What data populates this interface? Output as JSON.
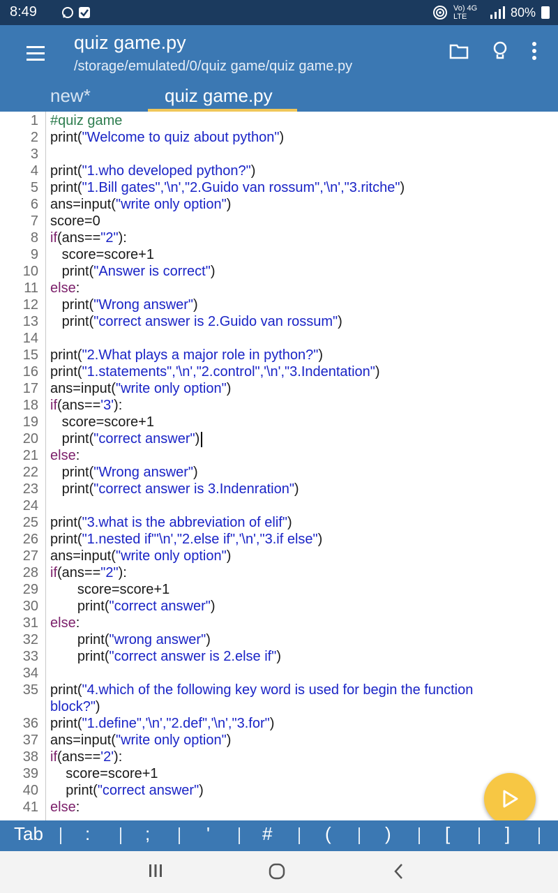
{
  "status": {
    "time": "8:49",
    "network_label": "Vo) 4G LTE",
    "battery": "80%",
    "icons": [
      "whatsapp-icon",
      "check-icon",
      "hotspot-icon",
      "signal-icon",
      "battery-icon"
    ]
  },
  "header": {
    "title": "quiz game.py",
    "path": "/storage/emulated/0/quiz game/quiz game.py",
    "icons": [
      "menu-icon",
      "folder-icon",
      "lightbulb-icon",
      "more-icon"
    ]
  },
  "tabs": [
    {
      "label": "new*",
      "active": false
    },
    {
      "label": "quiz game.py",
      "active": true
    }
  ],
  "editor": {
    "lines": [
      {
        "num": "1",
        "indent": "",
        "segs": [
          {
            "t": "#quiz game",
            "c": "comment"
          }
        ]
      },
      {
        "num": "2",
        "indent": "",
        "segs": [
          {
            "t": "print(",
            "c": "plain"
          },
          {
            "t": "\"Welcome to quiz about python\"",
            "c": "str"
          },
          {
            "t": ")",
            "c": "plain"
          }
        ]
      },
      {
        "num": "3",
        "indent": "",
        "segs": []
      },
      {
        "num": "4",
        "indent": "",
        "segs": [
          {
            "t": "print(",
            "c": "plain"
          },
          {
            "t": "\"1.who developed python?\"",
            "c": "str"
          },
          {
            "t": ")",
            "c": "plain"
          }
        ]
      },
      {
        "num": "5",
        "indent": "",
        "segs": [
          {
            "t": "print(",
            "c": "plain"
          },
          {
            "t": "\"1.Bill gates\",'\\n',\"2.Guido van rossum\",'\\n',\"3.ritche\"",
            "c": "str"
          },
          {
            "t": ")",
            "c": "plain"
          }
        ]
      },
      {
        "num": "6",
        "indent": "",
        "segs": [
          {
            "t": "ans=input(",
            "c": "plain"
          },
          {
            "t": "\"write only option\"",
            "c": "str"
          },
          {
            "t": ")",
            "c": "plain"
          }
        ]
      },
      {
        "num": "7",
        "indent": "",
        "segs": [
          {
            "t": "score=0",
            "c": "plain"
          }
        ]
      },
      {
        "num": "8",
        "indent": "",
        "segs": [
          {
            "t": "if",
            "c": "kw"
          },
          {
            "t": "(ans==",
            "c": "plain"
          },
          {
            "t": "\"2\"",
            "c": "str"
          },
          {
            "t": "):",
            "c": "plain"
          }
        ]
      },
      {
        "num": "9",
        "indent": "   ",
        "segs": [
          {
            "t": "score=score+1",
            "c": "plain"
          }
        ]
      },
      {
        "num": "10",
        "indent": "   ",
        "segs": [
          {
            "t": "print(",
            "c": "plain"
          },
          {
            "t": "\"Answer is correct\"",
            "c": "str"
          },
          {
            "t": ")",
            "c": "plain"
          }
        ]
      },
      {
        "num": "11",
        "indent": "",
        "segs": [
          {
            "t": "else",
            "c": "kw"
          },
          {
            "t": ":",
            "c": "plain"
          }
        ]
      },
      {
        "num": "12",
        "indent": "   ",
        "segs": [
          {
            "t": "print(",
            "c": "plain"
          },
          {
            "t": "\"Wrong answer\"",
            "c": "str"
          },
          {
            "t": ")",
            "c": "plain"
          }
        ]
      },
      {
        "num": "13",
        "indent": "   ",
        "segs": [
          {
            "t": "print(",
            "c": "plain"
          },
          {
            "t": "\"correct answer is 2.Guido van rossum\"",
            "c": "str"
          },
          {
            "t": ")",
            "c": "plain"
          }
        ]
      },
      {
        "num": "14",
        "indent": "",
        "segs": []
      },
      {
        "num": "15",
        "indent": "",
        "segs": [
          {
            "t": "print(",
            "c": "plain"
          },
          {
            "t": "\"2.What plays a major role in python?\"",
            "c": "str"
          },
          {
            "t": ")",
            "c": "plain"
          }
        ]
      },
      {
        "num": "16",
        "indent": "",
        "segs": [
          {
            "t": "print(",
            "c": "plain"
          },
          {
            "t": "\"1.statements\",'\\n',\"2.control\",'\\n',\"3.Indentation\"",
            "c": "str"
          },
          {
            "t": ")",
            "c": "plain"
          }
        ]
      },
      {
        "num": "17",
        "indent": "",
        "segs": [
          {
            "t": "ans=input(",
            "c": "plain"
          },
          {
            "t": "\"write only option\"",
            "c": "str"
          },
          {
            "t": ")",
            "c": "plain"
          }
        ]
      },
      {
        "num": "18",
        "indent": "",
        "segs": [
          {
            "t": "if",
            "c": "kw"
          },
          {
            "t": "(ans==",
            "c": "plain"
          },
          {
            "t": "'3'",
            "c": "str"
          },
          {
            "t": "):",
            "c": "plain"
          }
        ]
      },
      {
        "num": "19",
        "indent": "   ",
        "segs": [
          {
            "t": "score=score+1",
            "c": "plain"
          }
        ]
      },
      {
        "num": "20",
        "indent": "   ",
        "segs": [
          {
            "t": "print(",
            "c": "plain"
          },
          {
            "t": "\"correct answer\"",
            "c": "str"
          },
          {
            "t": ")",
            "c": "plain"
          }
        ],
        "cursor": true
      },
      {
        "num": "21",
        "indent": "",
        "segs": [
          {
            "t": "else",
            "c": "kw"
          },
          {
            "t": ":",
            "c": "plain"
          }
        ]
      },
      {
        "num": "22",
        "indent": "   ",
        "segs": [
          {
            "t": "print(",
            "c": "plain"
          },
          {
            "t": "\"Wrong answer\"",
            "c": "str"
          },
          {
            "t": ")",
            "c": "plain"
          }
        ]
      },
      {
        "num": "23",
        "indent": "   ",
        "segs": [
          {
            "t": "print(",
            "c": "plain"
          },
          {
            "t": "\"correct answer is 3.Indenration\"",
            "c": "str"
          },
          {
            "t": ")",
            "c": "plain"
          }
        ]
      },
      {
        "num": "24",
        "indent": "",
        "segs": []
      },
      {
        "num": "25",
        "indent": "",
        "segs": [
          {
            "t": "print(",
            "c": "plain"
          },
          {
            "t": "\"3.what is the abbreviation of elif\"",
            "c": "str"
          },
          {
            "t": ")",
            "c": "plain"
          }
        ]
      },
      {
        "num": "26",
        "indent": "",
        "segs": [
          {
            "t": "print(",
            "c": "plain"
          },
          {
            "t": "\"1.nested if\"'\\n',\"2.else if\",'\\n',\"3.if else\"",
            "c": "str"
          },
          {
            "t": ")",
            "c": "plain"
          }
        ]
      },
      {
        "num": "27",
        "indent": "",
        "segs": [
          {
            "t": "ans=input(",
            "c": "plain"
          },
          {
            "t": "\"write only option\"",
            "c": "str"
          },
          {
            "t": ")",
            "c": "plain"
          }
        ]
      },
      {
        "num": "28",
        "indent": "",
        "segs": [
          {
            "t": "if",
            "c": "kw"
          },
          {
            "t": "(ans==",
            "c": "plain"
          },
          {
            "t": "\"2\"",
            "c": "str"
          },
          {
            "t": "):",
            "c": "plain"
          }
        ]
      },
      {
        "num": "29",
        "indent": "       ",
        "segs": [
          {
            "t": "score=score+1",
            "c": "plain"
          }
        ]
      },
      {
        "num": "30",
        "indent": "       ",
        "segs": [
          {
            "t": "print(",
            "c": "plain"
          },
          {
            "t": "\"correct answer\"",
            "c": "str"
          },
          {
            "t": ")",
            "c": "plain"
          }
        ]
      },
      {
        "num": "31",
        "indent": "",
        "segs": [
          {
            "t": "else",
            "c": "kw"
          },
          {
            "t": ":",
            "c": "plain"
          }
        ]
      },
      {
        "num": "32",
        "indent": "       ",
        "segs": [
          {
            "t": "print(",
            "c": "plain"
          },
          {
            "t": "\"wrong answer\"",
            "c": "str"
          },
          {
            "t": ")",
            "c": "plain"
          }
        ]
      },
      {
        "num": "33",
        "indent": "       ",
        "segs": [
          {
            "t": "print(",
            "c": "plain"
          },
          {
            "t": "\"correct answer is 2.else if\"",
            "c": "str"
          },
          {
            "t": ")",
            "c": "plain"
          }
        ]
      },
      {
        "num": "34",
        "indent": "",
        "segs": []
      },
      {
        "num": "35",
        "indent": "",
        "segs": [
          {
            "t": "print(",
            "c": "plain"
          },
          {
            "t": "\"4.which of the following key word is used for begin the function",
            "c": "str"
          }
        ]
      },
      {
        "num": "",
        "indent": "",
        "segs": [
          {
            "t": "block?\"",
            "c": "str"
          },
          {
            "t": ")",
            "c": "plain"
          }
        ]
      },
      {
        "num": "36",
        "indent": "",
        "segs": [
          {
            "t": "print(",
            "c": "plain"
          },
          {
            "t": "\"1.define\",'\\n',\"2.def\",'\\n',\"3.for\"",
            "c": "str"
          },
          {
            "t": ")",
            "c": "plain"
          }
        ]
      },
      {
        "num": "37",
        "indent": "",
        "segs": [
          {
            "t": "ans=input(",
            "c": "plain"
          },
          {
            "t": "\"write only option\"",
            "c": "str"
          },
          {
            "t": ")",
            "c": "plain"
          }
        ]
      },
      {
        "num": "38",
        "indent": "",
        "segs": [
          {
            "t": "if",
            "c": "kw"
          },
          {
            "t": "(ans==",
            "c": "plain"
          },
          {
            "t": "'2'",
            "c": "str"
          },
          {
            "t": "):",
            "c": "plain"
          }
        ]
      },
      {
        "num": "39",
        "indent": "    ",
        "segs": [
          {
            "t": "score=score+1",
            "c": "plain"
          }
        ]
      },
      {
        "num": "40",
        "indent": "    ",
        "segs": [
          {
            "t": "print(",
            "c": "plain"
          },
          {
            "t": "\"correct answer\"",
            "c": "str"
          },
          {
            "t": ")",
            "c": "plain"
          }
        ]
      },
      {
        "num": "41",
        "indent": "",
        "segs": [
          {
            "t": "else",
            "c": "kw"
          },
          {
            "t": ":",
            "c": "plain"
          }
        ]
      }
    ]
  },
  "colors": {
    "statusbar": "#1b3a5e",
    "appbar": "#3b78b3",
    "tab_indicator": "#f0c75a",
    "comment": "#2e7d4f",
    "keyword": "#7b1f6a",
    "string": "#1a24c6",
    "fab": "#f7c744"
  },
  "run_button": {
    "icon": "play-icon"
  },
  "keybar": {
    "keys": [
      "Tab",
      ":",
      ";",
      "'",
      "#",
      "(",
      ")",
      "[",
      "]"
    ]
  },
  "nav": {
    "icons": [
      "recents-icon",
      "home-icon",
      "back-icon"
    ]
  }
}
